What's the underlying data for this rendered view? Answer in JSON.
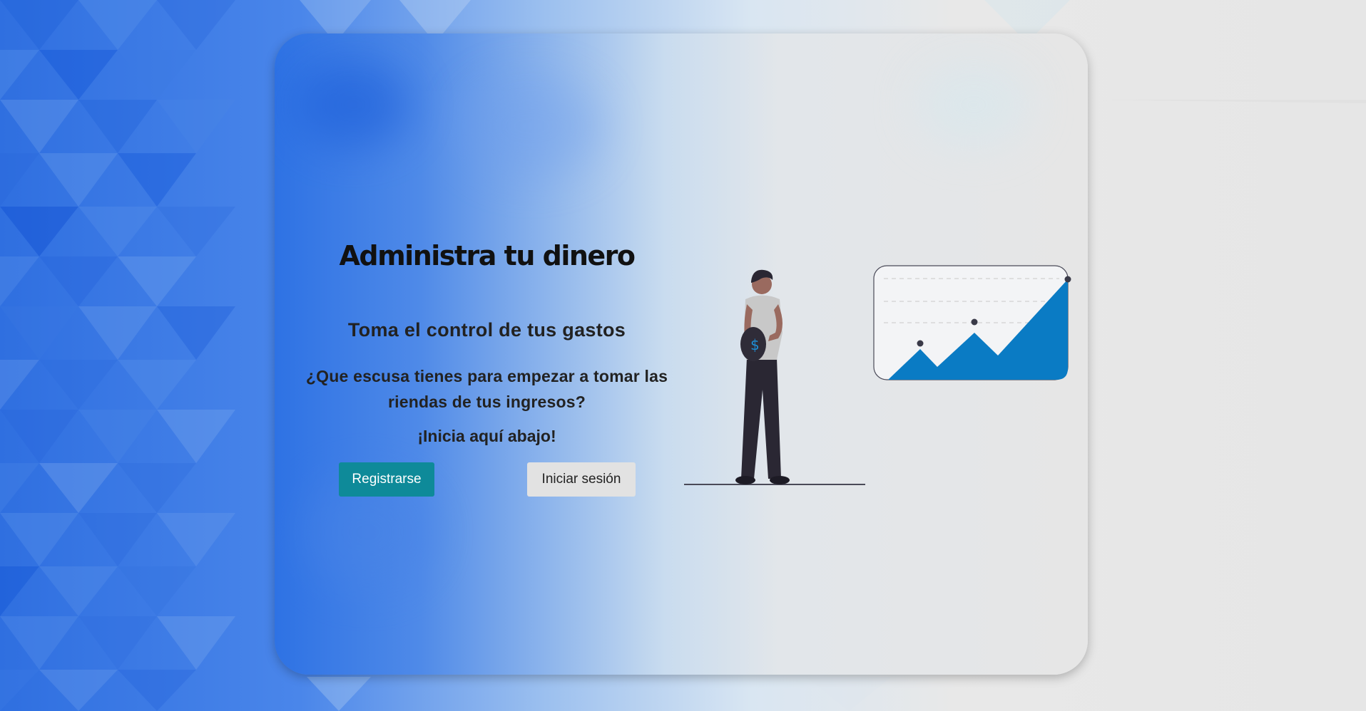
{
  "hero": {
    "title": "Administra tu dinero",
    "subtitle": "Toma el control de tus gastos",
    "question": "¿Que escusa tienes para empezar a tomar las riendas de tus ingresos?",
    "call_to_action": "¡Inicia aquí abajo!"
  },
  "buttons": {
    "register_label": "Registrarse",
    "login_label": "Iniciar sesión"
  },
  "illustration": {
    "coin_symbol": "$",
    "accent_color": "#0a7bc4"
  },
  "colors": {
    "register_button": "#0e8a99",
    "login_button": "#e2e2e2"
  }
}
